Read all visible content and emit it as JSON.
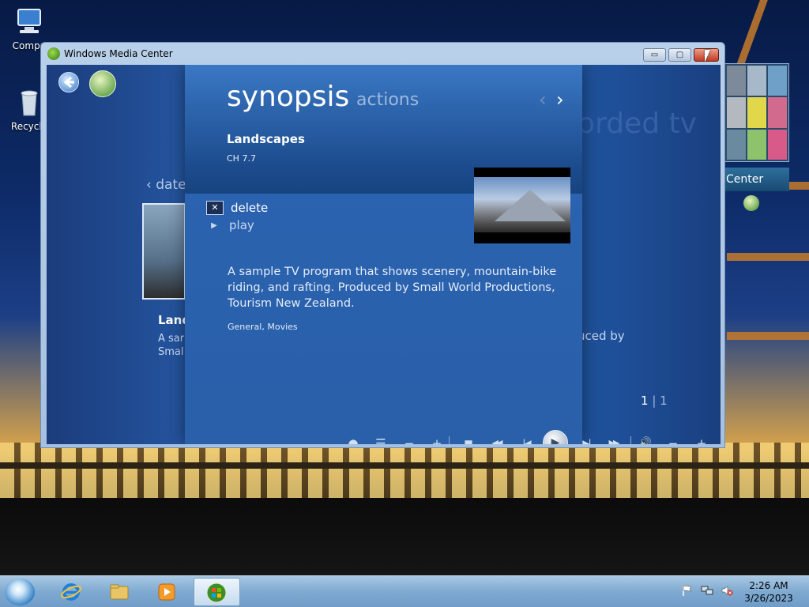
{
  "desktop": {
    "icons": [
      {
        "label": "Compu"
      },
      {
        "label": "Recycle"
      }
    ]
  },
  "gadget": {
    "label": "Center"
  },
  "window": {
    "title": "Windows Media Center",
    "buttons": {
      "minimize": "▭",
      "maximize": "▢",
      "close": "✕"
    }
  },
  "background_page": {
    "nav_label": "date",
    "item_title": "Land",
    "item_line1": "A sar",
    "item_line2": "Smal",
    "section_title": "orded tv",
    "produced_fragment": "uced by"
  },
  "details": {
    "tabs": {
      "active": "synopsis",
      "inactive": "actions"
    },
    "program_title": "Landscapes",
    "channel": "CH 7.7",
    "actions": [
      {
        "label": "delete",
        "icon": "delete-x-icon"
      },
      {
        "label": "play",
        "icon": "play-triangle-icon"
      }
    ],
    "description": "A sample TV program that shows scenery, mountain-bike riding, and rafting. Produced by Small World Productions, Tourism New Zealand.",
    "genres": "General, Movies"
  },
  "pager": {
    "current": "1",
    "separator": "|",
    "total": "1"
  },
  "transport": {
    "record": "●",
    "guide": "☰",
    "channel_down": "−",
    "channel_up": "+",
    "stop": "■",
    "rewind": "◀◀",
    "skip_back": "|◀",
    "play": "▶",
    "skip_forward": "▶|",
    "fast_forward": "▶▶",
    "mute": "🔊",
    "vol_down": "−",
    "vol_up": "+"
  },
  "taskbar": {
    "clock_time": "2:26 AM",
    "clock_date": "3/26/2023"
  },
  "colors": {
    "accent": "#2a5fa9",
    "close": "#c23a20"
  }
}
